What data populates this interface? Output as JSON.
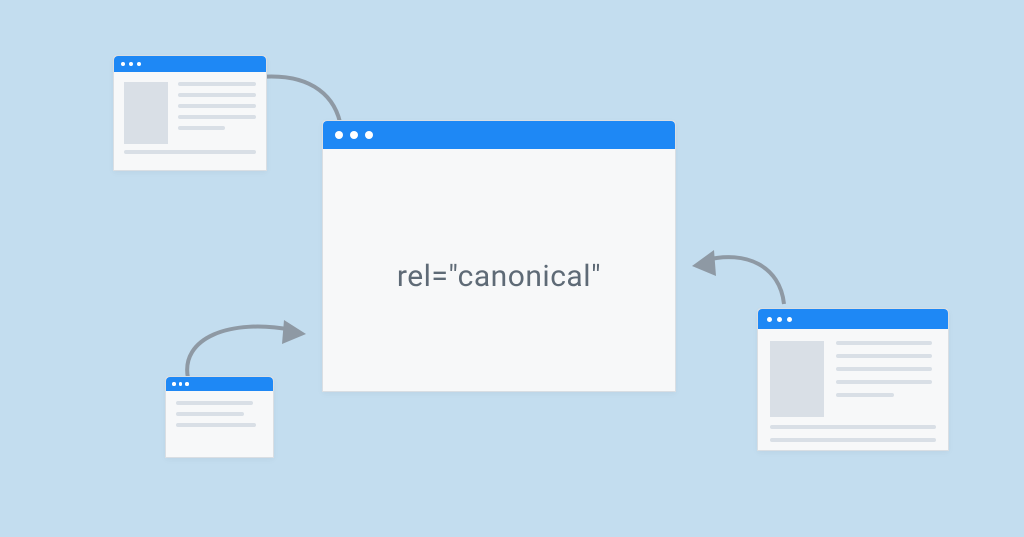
{
  "concept": {
    "label": "rel=\"canonical\""
  },
  "colors": {
    "background": "#c3ddef",
    "window_bg": "#f7f8f9",
    "titlebar": "#1e88f5",
    "placeholder": "#d9dfe6",
    "arrow": "#8e99a4",
    "text": "#5e6a76"
  },
  "diagram": {
    "description": "Three duplicate-content browser windows point via arrows into a central canonical page window.",
    "central_window": {
      "role": "canonical-page",
      "label_path": "concept.label"
    },
    "source_windows": [
      {
        "id": "top-left",
        "role": "duplicate-page",
        "layout": "thumb+lines"
      },
      {
        "id": "bottom-left",
        "role": "duplicate-page",
        "layout": "lines-only"
      },
      {
        "id": "right",
        "role": "duplicate-page",
        "layout": "thumb+lines"
      }
    ],
    "arrows": [
      {
        "from": "top-left",
        "to": "center"
      },
      {
        "from": "bottom-left",
        "to": "center"
      },
      {
        "from": "right",
        "to": "center"
      }
    ]
  }
}
